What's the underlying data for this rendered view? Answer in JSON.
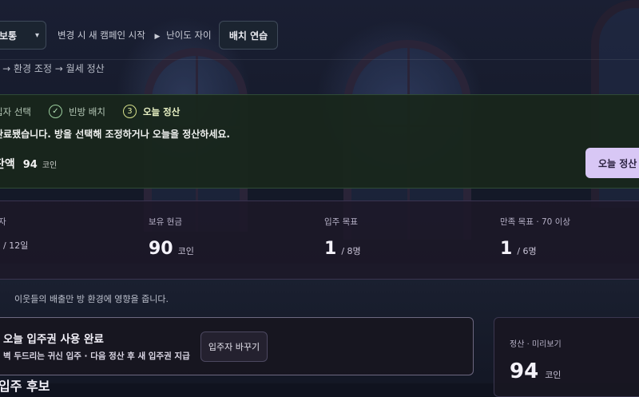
{
  "toolbar": {
    "difficulty_value": "보통",
    "note": "변경 시 새 캠페인 시작",
    "difficulty_hint": "난이도 자이",
    "batch_button": "배치 연습"
  },
  "flow_text": "l → 환경 조정 → 월세 정산",
  "steps": [
    {
      "label": "입자 선택",
      "icon": "check-icon",
      "mark": ""
    },
    {
      "label": "빈방 배치",
      "icon": "check-icon",
      "mark": "✓"
    },
    {
      "label": "오늘 정산",
      "icon": "step-number-icon",
      "mark": "3"
    }
  ],
  "panel": {
    "message": "완료됐습니다. 방을 선택해 조정하거나 오늘을 정산하세요.",
    "balance_label": "잔액",
    "balance_value": "94",
    "balance_unit": "코인",
    "settle_button": "오늘 정산"
  },
  "stats": [
    {
      "caption": "자",
      "value": "",
      "unit": "/ 12일"
    },
    {
      "caption": "보유 현금",
      "value": "90",
      "unit": "코인"
    },
    {
      "caption": "입주 목표",
      "value": "1",
      "unit": "/ 8명"
    },
    {
      "caption": "만족 목표 · 70 이상",
      "value": "1",
      "unit": "/ 6명"
    }
  ],
  "note": "이웃들의 배출만 방 환경에 영향을 줍니다.",
  "ticket": {
    "title": "오늘 입주권 사용 완료",
    "detail": "벽 두드리는 귀신 입주 · 다음 정산 후 새 입주권 지급",
    "swap_button": "입주자 바꾸기"
  },
  "cut_heading": "입주 후보",
  "preview": {
    "caption": "정산 · 미리보기",
    "value": "94",
    "unit": "코인"
  },
  "colors": {
    "panel_bg": "#18261c",
    "settle_button": "#d8c7f5",
    "step_accent": "#9ccf9f"
  }
}
